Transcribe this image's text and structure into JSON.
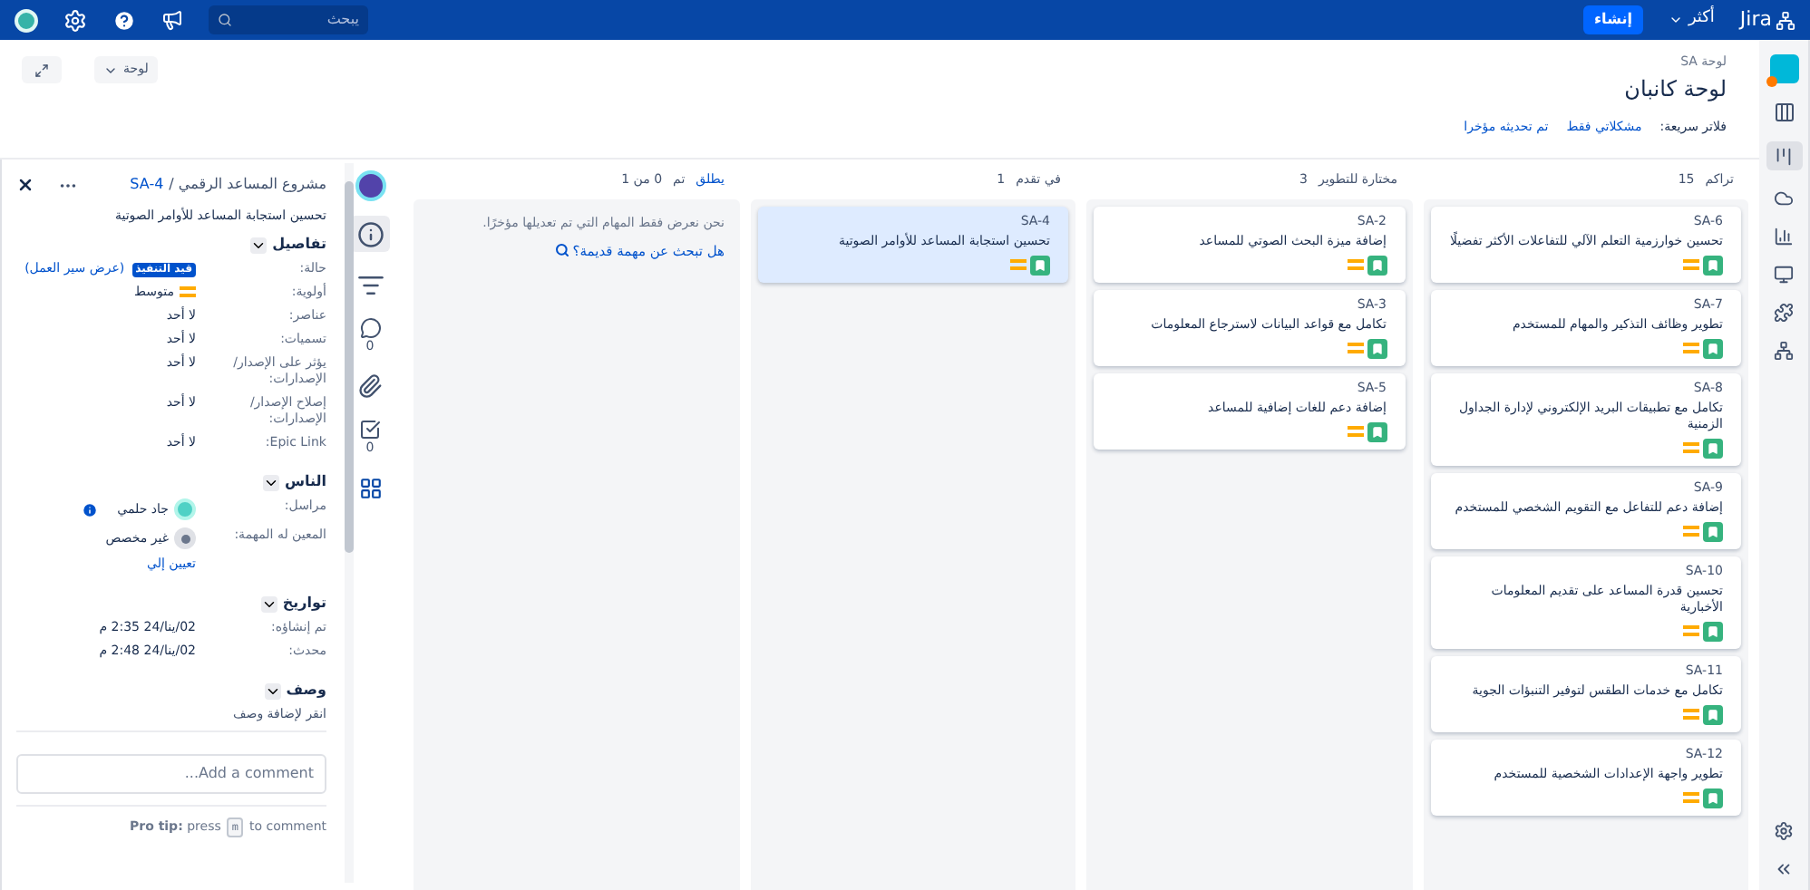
{
  "top_nav": {
    "logo": "Jira",
    "more": "أكثر",
    "create": "إنشاء",
    "search": {
      "placeholder": "يبحث"
    }
  },
  "header": {
    "breadcrumb": "لوحة SA",
    "title": "لوحة كانبان",
    "quick_filters_label": "فلاتر سريعة:",
    "quick_filters": [
      "مشكلاتي فقط",
      "تم تحديثه مؤخرا"
    ],
    "board_button": "لوحة"
  },
  "columns": [
    {
      "title": "تراكم",
      "count": "15",
      "cards": [
        {
          "key": "SA-6",
          "title": "تحسين خوارزمية التعلم الآلي للتفاعلات الأكثر تفضيلًا",
          "selected": false
        },
        {
          "key": "SA-7",
          "title": "تطوير وظائف التذكير والمهام للمستخدم",
          "selected": false
        },
        {
          "key": "SA-8",
          "title": "تكامل مع تطبيقات البريد الإلكتروني لإدارة الجداول الزمنية",
          "selected": false
        },
        {
          "key": "SA-9",
          "title": "إضافة دعم للتفاعل مع التقويم الشخصي للمستخدم",
          "selected": false
        },
        {
          "key": "SA-10",
          "title": "تحسين قدرة المساعد على تقديم المعلومات الأخبارية",
          "selected": false
        },
        {
          "key": "SA-11",
          "title": "تكامل مع خدمات الطقس لتوفير التنبؤات الجوية",
          "selected": false
        },
        {
          "key": "SA-12",
          "title": "تطوير واجهة الإعدادات الشخصية للمستخدم",
          "selected": false
        }
      ]
    },
    {
      "title": "مختارة للتطوير",
      "count": "3",
      "cards": [
        {
          "key": "SA-2",
          "title": "إضافة ميزة البحث الصوتي للمساعد",
          "selected": false
        },
        {
          "key": "SA-3",
          "title": "تكامل مع قواعد البيانات لاسترجاع المعلومات",
          "selected": false
        },
        {
          "key": "SA-5",
          "title": "إضافة دعم للغات إضافية للمساعد",
          "selected": false
        }
      ]
    },
    {
      "title": "في تقدم",
      "count": "1",
      "cards": [
        {
          "key": "SA-4",
          "title": "تحسين استجابة المساعد للأوامر الصوتية",
          "selected": true
        }
      ]
    },
    {
      "title": "تم",
      "count": "0 من 1",
      "action": "يطلق",
      "note": "نحن نعرض فقط المهام التي تم تعديلها مؤخرًا.",
      "link": "هل تبحث عن مهمة قديمة؟"
    }
  ],
  "detail": {
    "project": "مشروع المساعد الرقمي /",
    "key": "SA-4",
    "title": "تحسين استجابة المساعد للأوامر الصوتية",
    "sections": [
      {
        "title": "تفاصيل",
        "fields": [
          {
            "label": "حالة:",
            "kind": "status",
            "value": "قيد التنفيذ",
            "link": "(عرض سير العمل)"
          },
          {
            "label": "أولوية:",
            "kind": "priority",
            "value": "متوسط"
          },
          {
            "label": "عناصر:",
            "kind": "text",
            "value": "لا أحد"
          },
          {
            "label": "تسميات:",
            "kind": "text",
            "value": "لا أحد"
          },
          {
            "label": "يؤثر على الإصدار/ الإصدارات:",
            "kind": "text",
            "value": "لا أحد"
          },
          {
            "label": "إصلاح الإصدار/ الإصدارات:",
            "kind": "text",
            "value": "لا أحد"
          },
          {
            "label": "Epic Link:",
            "kind": "text",
            "value": "لا أحد"
          }
        ]
      },
      {
        "title": "الناس",
        "fields": [
          {
            "label": "مراسل:",
            "kind": "user",
            "value": "جاد حلمي"
          },
          {
            "label": "المعين له المهمة:",
            "kind": "unassigned",
            "value": "غير مخصص",
            "link": "تعيين إلي"
          }
        ]
      },
      {
        "title": "تواريخ",
        "fields": [
          {
            "label": "تم إنشاؤه:",
            "kind": "text",
            "value": "02/ينا/24 2:35 م"
          },
          {
            "label": "محدث:",
            "kind": "text",
            "value": "02/ينا/24 2:48 م"
          }
        ]
      },
      {
        "title": "وصف",
        "fields": [
          {
            "label": "انقر لإضافة وصف",
            "kind": "hint"
          }
        ]
      }
    ],
    "comment": {
      "placeholder": "Add a comment..."
    },
    "tip": "**Pro tip:** press",
    "tip_key": "m",
    "tip_end": "to comment",
    "tabs": [
      {
        "kind": "info",
        "selected": true
      },
      {
        "kind": "list",
        "selected": false
      },
      {
        "kind": "comments",
        "selected": false,
        "count": "0"
      },
      {
        "kind": "attachments",
        "selected": false
      },
      {
        "kind": "checklist",
        "selected": false,
        "count": "0"
      },
      {
        "kind": "app",
        "selected": false
      }
    ]
  }
}
